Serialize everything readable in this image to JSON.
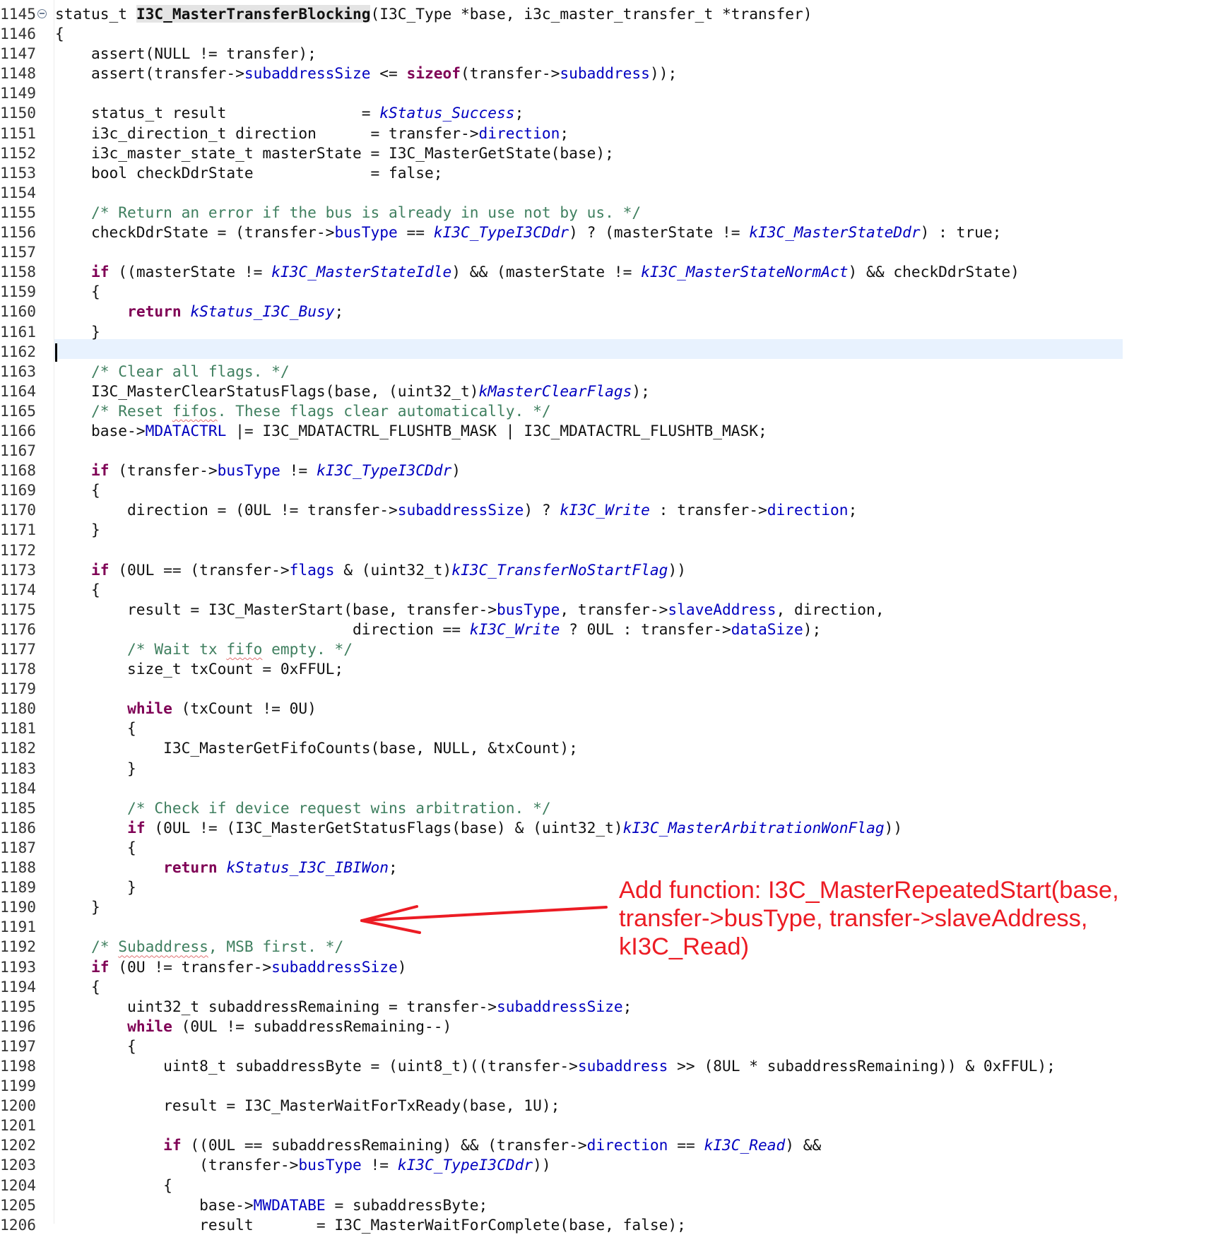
{
  "editor": {
    "lines": [
      {
        "n": "1145",
        "tokens": [
          [
            "t",
            "status_t "
          ],
          [
            "fn",
            "I3C_MasterTransferBlocking"
          ],
          [
            "t",
            "(I3C_Type *base, i3c_master_transfer_t *transfer)"
          ]
        ]
      },
      {
        "n": "1146",
        "tokens": [
          [
            "t",
            "{"
          ]
        ]
      },
      {
        "n": "1147",
        "tokens": [
          [
            "t",
            "    assert(NULL != transfer);"
          ]
        ]
      },
      {
        "n": "1148",
        "tokens": [
          [
            "t",
            "    assert(transfer->"
          ],
          [
            "fld",
            "subaddressSize"
          ],
          [
            "t",
            " <= "
          ],
          [
            "kw",
            "sizeof"
          ],
          [
            "t",
            "(transfer->"
          ],
          [
            "fld",
            "subaddress"
          ],
          [
            "t",
            "));"
          ]
        ]
      },
      {
        "n": "1149",
        "tokens": []
      },
      {
        "n": "1150",
        "tokens": [
          [
            "t",
            "    status_t result               = "
          ],
          [
            "en",
            "kStatus_Success"
          ],
          [
            "t",
            ";"
          ]
        ]
      },
      {
        "n": "1151",
        "tokens": [
          [
            "t",
            "    i3c_direction_t direction      = transfer->"
          ],
          [
            "fld",
            "direction"
          ],
          [
            "t",
            ";"
          ]
        ]
      },
      {
        "n": "1152",
        "tokens": [
          [
            "t",
            "    i3c_master_state_t masterState = I3C_MasterGetState(base);"
          ]
        ]
      },
      {
        "n": "1153",
        "tokens": [
          [
            "t",
            "    bool checkDdrState             = false;"
          ]
        ]
      },
      {
        "n": "1154",
        "tokens": []
      },
      {
        "n": "1155",
        "tokens": [
          [
            "cm",
            "    /* Return an error if the bus is already in use not by us. */"
          ]
        ]
      },
      {
        "n": "1156",
        "tokens": [
          [
            "t",
            "    checkDdrState = (transfer->"
          ],
          [
            "fld",
            "busType"
          ],
          [
            "t",
            " == "
          ],
          [
            "en",
            "kI3C_TypeI3CDdr"
          ],
          [
            "t",
            ") ? (masterState != "
          ],
          [
            "en",
            "kI3C_MasterStateDdr"
          ],
          [
            "t",
            ") : true;"
          ]
        ]
      },
      {
        "n": "1157",
        "tokens": []
      },
      {
        "n": "1158",
        "tokens": [
          [
            "t",
            "    "
          ],
          [
            "kw",
            "if"
          ],
          [
            "t",
            " ((masterState != "
          ],
          [
            "en",
            "kI3C_MasterStateIdle"
          ],
          [
            "t",
            ") && (masterState != "
          ],
          [
            "en",
            "kI3C_MasterStateNormAct"
          ],
          [
            "t",
            ") && checkDdrState)"
          ]
        ]
      },
      {
        "n": "1159",
        "tokens": [
          [
            "t",
            "    {"
          ]
        ]
      },
      {
        "n": "1160",
        "tokens": [
          [
            "t",
            "        "
          ],
          [
            "kw",
            "return"
          ],
          [
            "t",
            " "
          ],
          [
            "en",
            "kStatus_I3C_Busy"
          ],
          [
            "t",
            ";"
          ]
        ]
      },
      {
        "n": "1161",
        "tokens": [
          [
            "t",
            "    }"
          ]
        ]
      },
      {
        "n": "1162",
        "tokens": [
          [
            "caret",
            ""
          ]
        ]
      },
      {
        "n": "1163",
        "tokens": [
          [
            "cm",
            "    /* Clear all flags. */"
          ]
        ]
      },
      {
        "n": "1164",
        "tokens": [
          [
            "t",
            "    I3C_MasterClearStatusFlags(base, (uint32_t)"
          ],
          [
            "en",
            "kMasterClearFlags"
          ],
          [
            "t",
            ");"
          ]
        ]
      },
      {
        "n": "1165",
        "tokens": [
          [
            "cm",
            "    /* Reset "
          ],
          [
            "cmsp",
            "fifos"
          ],
          [
            "cm",
            ". These flags clear automatically. */"
          ]
        ]
      },
      {
        "n": "1166",
        "tokens": [
          [
            "t",
            "    base->"
          ],
          [
            "fld",
            "MDATACTRL"
          ],
          [
            "t",
            " |= I3C_MDATACTRL_FLUSHTB_MASK | I3C_MDATACTRL_FLUSHTB_MASK;"
          ]
        ]
      },
      {
        "n": "1167",
        "tokens": []
      },
      {
        "n": "1168",
        "tokens": [
          [
            "t",
            "    "
          ],
          [
            "kw",
            "if"
          ],
          [
            "t",
            " (transfer->"
          ],
          [
            "fld",
            "busType"
          ],
          [
            "t",
            " != "
          ],
          [
            "en",
            "kI3C_TypeI3CDdr"
          ],
          [
            "t",
            ")"
          ]
        ]
      },
      {
        "n": "1169",
        "tokens": [
          [
            "t",
            "    {"
          ]
        ]
      },
      {
        "n": "1170",
        "tokens": [
          [
            "t",
            "        direction = (0UL != transfer->"
          ],
          [
            "fld",
            "subaddressSize"
          ],
          [
            "t",
            ") ? "
          ],
          [
            "en",
            "kI3C_Write"
          ],
          [
            "t",
            " : transfer->"
          ],
          [
            "fld",
            "direction"
          ],
          [
            "t",
            ";"
          ]
        ]
      },
      {
        "n": "1171",
        "tokens": [
          [
            "t",
            "    }"
          ]
        ]
      },
      {
        "n": "1172",
        "tokens": []
      },
      {
        "n": "1173",
        "tokens": [
          [
            "t",
            "    "
          ],
          [
            "kw",
            "if"
          ],
          [
            "t",
            " (0UL == (transfer->"
          ],
          [
            "fld",
            "flags"
          ],
          [
            "t",
            " & (uint32_t)"
          ],
          [
            "en",
            "kI3C_TransferNoStartFlag"
          ],
          [
            "t",
            "))"
          ]
        ]
      },
      {
        "n": "1174",
        "tokens": [
          [
            "t",
            "    {"
          ]
        ]
      },
      {
        "n": "1175",
        "tokens": [
          [
            "t",
            "        result = I3C_MasterStart(base, transfer->"
          ],
          [
            "fld",
            "busType"
          ],
          [
            "t",
            ", transfer->"
          ],
          [
            "fld",
            "slaveAddress"
          ],
          [
            "t",
            ", direction,"
          ]
        ]
      },
      {
        "n": "1176",
        "tokens": [
          [
            "t",
            "                                 direction == "
          ],
          [
            "en",
            "kI3C_Write"
          ],
          [
            "t",
            " ? 0UL : transfer->"
          ],
          [
            "fld",
            "dataSize"
          ],
          [
            "t",
            ");"
          ]
        ]
      },
      {
        "n": "1177",
        "tokens": [
          [
            "cm",
            "        /* Wait tx "
          ],
          [
            "cmsp",
            "fifo"
          ],
          [
            "cm",
            " empty. */"
          ]
        ]
      },
      {
        "n": "1178",
        "tokens": [
          [
            "t",
            "        size_t txCount = 0xFFUL;"
          ]
        ]
      },
      {
        "n": "1179",
        "tokens": []
      },
      {
        "n": "1180",
        "tokens": [
          [
            "t",
            "        "
          ],
          [
            "kw",
            "while"
          ],
          [
            "t",
            " (txCount != 0U)"
          ]
        ]
      },
      {
        "n": "1181",
        "tokens": [
          [
            "t",
            "        {"
          ]
        ]
      },
      {
        "n": "1182",
        "tokens": [
          [
            "t",
            "            I3C_MasterGetFifoCounts(base, NULL, &txCount);"
          ]
        ]
      },
      {
        "n": "1183",
        "tokens": [
          [
            "t",
            "        }"
          ]
        ]
      },
      {
        "n": "1184",
        "tokens": []
      },
      {
        "n": "1185",
        "tokens": [
          [
            "cm",
            "        /* Check if device request wins arbitration. */"
          ]
        ]
      },
      {
        "n": "1186",
        "tokens": [
          [
            "t",
            "        "
          ],
          [
            "kw",
            "if"
          ],
          [
            "t",
            " (0UL != (I3C_MasterGetStatusFlags(base) & (uint32_t)"
          ],
          [
            "en",
            "kI3C_MasterArbitrationWonFlag"
          ],
          [
            "t",
            "))"
          ]
        ]
      },
      {
        "n": "1187",
        "tokens": [
          [
            "t",
            "        {"
          ]
        ]
      },
      {
        "n": "1188",
        "tokens": [
          [
            "t",
            "            "
          ],
          [
            "kw",
            "return"
          ],
          [
            "t",
            " "
          ],
          [
            "en",
            "kStatus_I3C_IBIWon"
          ],
          [
            "t",
            ";"
          ]
        ]
      },
      {
        "n": "1189",
        "tokens": [
          [
            "t",
            "        }"
          ]
        ]
      },
      {
        "n": "1190",
        "tokens": [
          [
            "t",
            "    }"
          ]
        ]
      },
      {
        "n": "1191",
        "tokens": []
      },
      {
        "n": "1192",
        "tokens": [
          [
            "cm",
            "    /* "
          ],
          [
            "cmsp",
            "Subaddress"
          ],
          [
            "cm",
            ", MSB first. */"
          ]
        ]
      },
      {
        "n": "1193",
        "tokens": [
          [
            "t",
            "    "
          ],
          [
            "kw",
            "if"
          ],
          [
            "t",
            " (0U != transfer->"
          ],
          [
            "fld",
            "subaddressSize"
          ],
          [
            "t",
            ")"
          ]
        ]
      },
      {
        "n": "1194",
        "tokens": [
          [
            "t",
            "    {"
          ]
        ]
      },
      {
        "n": "1195",
        "tokens": [
          [
            "t",
            "        uint32_t subaddressRemaining = transfer->"
          ],
          [
            "fld",
            "subaddressSize"
          ],
          [
            "t",
            ";"
          ]
        ]
      },
      {
        "n": "1196",
        "tokens": [
          [
            "t",
            "        "
          ],
          [
            "kw",
            "while"
          ],
          [
            "t",
            " (0UL != subaddressRemaining--)"
          ]
        ]
      },
      {
        "n": "1197",
        "tokens": [
          [
            "t",
            "        {"
          ]
        ]
      },
      {
        "n": "1198",
        "tokens": [
          [
            "t",
            "            uint8_t subaddressByte = (uint8_t)((transfer->"
          ],
          [
            "fld",
            "subaddress"
          ],
          [
            "t",
            " >> (8UL * subaddressRemaining)) & 0xFFUL);"
          ]
        ]
      },
      {
        "n": "1199",
        "tokens": []
      },
      {
        "n": "1200",
        "tokens": [
          [
            "t",
            "            result = I3C_MasterWaitForTxReady(base, 1U);"
          ]
        ]
      },
      {
        "n": "1201",
        "tokens": []
      },
      {
        "n": "1202",
        "tokens": [
          [
            "t",
            "            "
          ],
          [
            "kw",
            "if"
          ],
          [
            "t",
            " ((0UL == subaddressRemaining) && (transfer->"
          ],
          [
            "fld",
            "direction"
          ],
          [
            "t",
            " == "
          ],
          [
            "en",
            "kI3C_Read"
          ],
          [
            "t",
            ") &&"
          ]
        ]
      },
      {
        "n": "1203",
        "tokens": [
          [
            "t",
            "                (transfer->"
          ],
          [
            "fld",
            "busType"
          ],
          [
            "t",
            " != "
          ],
          [
            "en",
            "kI3C_TypeI3CDdr"
          ],
          [
            "t",
            "))"
          ]
        ]
      },
      {
        "n": "1204",
        "tokens": [
          [
            "t",
            "            {"
          ]
        ]
      },
      {
        "n": "1205",
        "tokens": [
          [
            "t",
            "                base->"
          ],
          [
            "fld",
            "MWDATABE"
          ],
          [
            "t",
            " = subaddressByte;"
          ]
        ]
      },
      {
        "n": "1206",
        "tokens": [
          [
            "t",
            "                result       = I3C_MasterWaitForComplete(base, false);"
          ]
        ]
      }
    ]
  },
  "annotation": {
    "line1": "Add function: I3C_MasterRepeatedStart(base,",
    "line2": "transfer->busType, transfer->slaveAddress,",
    "line3": "kI3C_Read)",
    "color": "#ec1c24"
  },
  "colors": {
    "keyword": "#7f0055",
    "field": "#0000c0",
    "comment": "#3f7f5f",
    "current_line": "#e8f2fe"
  }
}
